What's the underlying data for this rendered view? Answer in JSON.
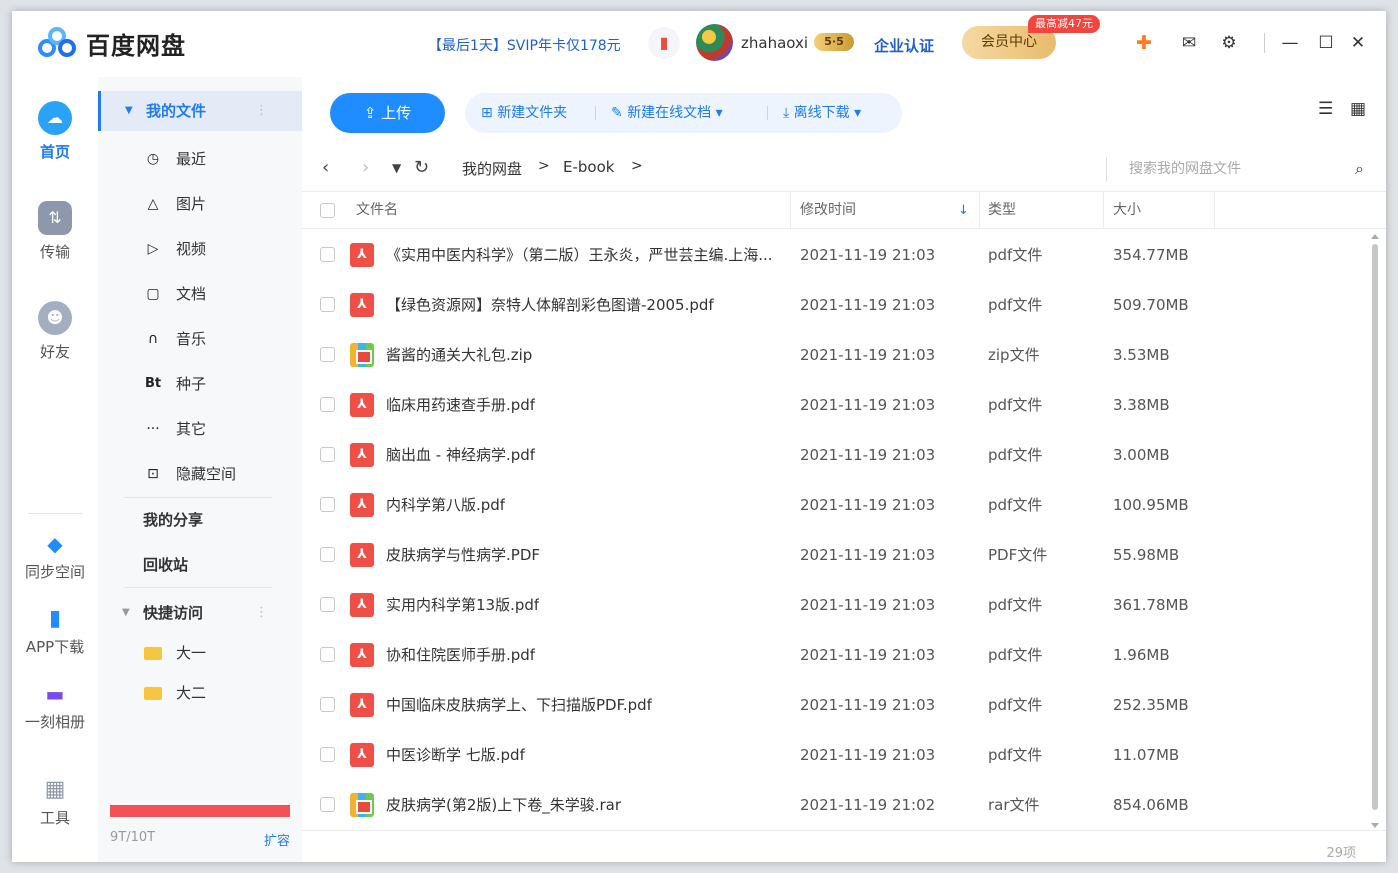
{
  "app": {
    "title": "百度网盘"
  },
  "header": {
    "promo": "【最后1天】SVIP年卡仅178元",
    "gift_icon": "gift-icon",
    "username": "zhahaoxi",
    "vip_badge": "5",
    "enterprise": "企业认证",
    "member_center": "会员中心",
    "discount_tag": "最高减47元",
    "icons": [
      "game-icon",
      "mail-icon",
      "settings-icon",
      "minimize-icon",
      "maximize-icon",
      "close-icon"
    ]
  },
  "leftnav": {
    "home": "首页",
    "transfer": "传输",
    "friends": "好友",
    "sync": "同步空间",
    "app_download": "APP下载",
    "album": "一刻相册",
    "tools": "工具"
  },
  "sidebar": {
    "my_files": "我的文件",
    "items": [
      "最近",
      "图片",
      "视频",
      "文档",
      "音乐",
      "种子",
      "其它",
      "隐藏空间"
    ],
    "torrent_icon": "Bt",
    "my_share": "我的分享",
    "recycle": "回收站",
    "quick_access": "快捷访问",
    "folders": [
      "大一",
      "大二"
    ],
    "quota": "9T/10T",
    "quota_used_fraction": 0.9,
    "expand": "扩容"
  },
  "toolbar": {
    "upload": "上传",
    "new_folder": "新建文件夹",
    "new_online_doc": "新建在线文档",
    "offline_download": "离线下载"
  },
  "path": {
    "crumbs": [
      "我的网盘",
      "E-book"
    ],
    "separator": ">"
  },
  "search": {
    "placeholder": "搜索我的网盘文件"
  },
  "table": {
    "columns": [
      "文件名",
      "修改时间",
      "类型",
      "大小"
    ],
    "rows": [
      {
        "name": "《实用中医内科学》（第二版）王永炎，严世芸主编.上海...",
        "date": "2021-11-19 21:03",
        "type": "pdf文件",
        "size": "354.77MB",
        "kind": "pdf"
      },
      {
        "name": "【绿色资源网】奈特人体解剖彩色图谱-2005.pdf",
        "date": "2021-11-19 21:03",
        "type": "pdf文件",
        "size": "509.70MB",
        "kind": "pdf"
      },
      {
        "name": "酱酱的通关大礼包.zip",
        "date": "2021-11-19 21:03",
        "type": "zip文件",
        "size": "3.53MB",
        "kind": "zip"
      },
      {
        "name": "临床用药速查手册.pdf",
        "date": "2021-11-19 21:03",
        "type": "pdf文件",
        "size": "3.38MB",
        "kind": "pdf"
      },
      {
        "name": "脑出血 - 神经病学.pdf",
        "date": "2021-11-19 21:03",
        "type": "pdf文件",
        "size": "3.00MB",
        "kind": "pdf"
      },
      {
        "name": "内科学第八版.pdf",
        "date": "2021-11-19 21:03",
        "type": "pdf文件",
        "size": "100.95MB",
        "kind": "pdf"
      },
      {
        "name": "皮肤病学与性病学.PDF",
        "date": "2021-11-19 21:03",
        "type": "PDF文件",
        "size": "55.98MB",
        "kind": "pdf"
      },
      {
        "name": "实用内科学第13版.pdf",
        "date": "2021-11-19 21:03",
        "type": "pdf文件",
        "size": "361.78MB",
        "kind": "pdf"
      },
      {
        "name": "协和住院医师手册.pdf",
        "date": "2021-11-19 21:03",
        "type": "pdf文件",
        "size": "1.96MB",
        "kind": "pdf"
      },
      {
        "name": "中国临床皮肤病学上、下扫描版PDF.pdf",
        "date": "2021-11-19 21:03",
        "type": "pdf文件",
        "size": "252.35MB",
        "kind": "pdf"
      },
      {
        "name": "中医诊断学 七版.pdf",
        "date": "2021-11-19 21:03",
        "type": "pdf文件",
        "size": "11.07MB",
        "kind": "pdf"
      },
      {
        "name": "皮肤病学(第2版)上下卷_朱学骏.rar",
        "date": "2021-11-19 21:02",
        "type": "rar文件",
        "size": "854.06MB",
        "kind": "zip"
      }
    ]
  },
  "footer": {
    "count": "29项"
  },
  "colors": {
    "accent": "#1f7bf0",
    "upload": "#1f8cff",
    "pdf": "#ef4f46",
    "quota": "#f25255"
  }
}
